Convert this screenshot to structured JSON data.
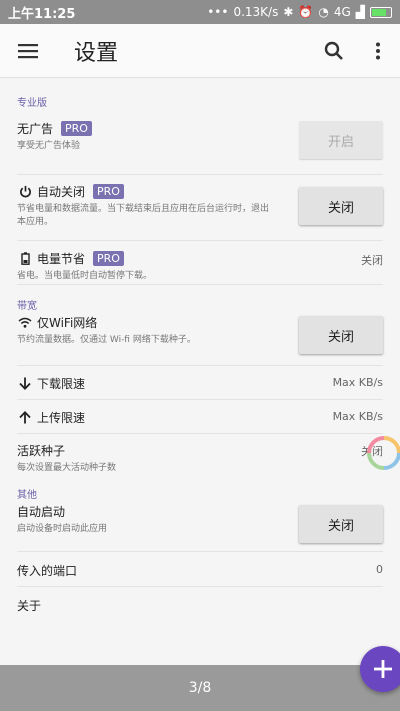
{
  "status": {
    "time": "上午11:25",
    "dots": "•••",
    "speed": "0.13K/s",
    "network": "4G"
  },
  "appbar": {
    "title": "设置",
    "menu_icon": "hamburger-menu-icon",
    "search_icon": "search-icon",
    "more_icon": "more-vert-icon"
  },
  "sections": {
    "pro": "专业版",
    "bandwidth": "带宽",
    "other": "其他"
  },
  "pro_badge": "PRO",
  "settings": {
    "no_ads": {
      "title": "无广告",
      "subtitle": "享受无广告体验",
      "button": "开启"
    },
    "auto_shutdown": {
      "title": "自动关闭",
      "subtitle": "节省电量和数据流量。当下载结束后且应用在后台运行时，退出本应用。",
      "button": "关闭"
    },
    "power_save": {
      "title": "电量节省",
      "subtitle": "省电。当电量低时自动暂停下载。",
      "value": "关闭"
    },
    "wifi_only": {
      "title": "仅WiFi网络",
      "subtitle": "节约流量数据。仅通过 Wi-fi 网络下载种子。",
      "button": "关闭"
    },
    "download_limit": {
      "title": "下载限速",
      "value": "Max KB/s"
    },
    "upload_limit": {
      "title": "上传限速",
      "value": "Max KB/s"
    },
    "active_seeds": {
      "title": "活跃种子",
      "subtitle": "每次设置最大活动种子数",
      "value": "关闭"
    },
    "auto_start": {
      "title": "自动启动",
      "subtitle": "启动设备时启动此应用",
      "button": "关闭"
    },
    "incoming_port": {
      "title": "传入的端口",
      "value": "0"
    },
    "about": {
      "title": "关于"
    }
  },
  "bottom": {
    "page_indicator": "3/8"
  },
  "colors": {
    "accent": "#6b46c1",
    "pro_badge": "#7a71b0",
    "section": "#6a5fa8"
  }
}
